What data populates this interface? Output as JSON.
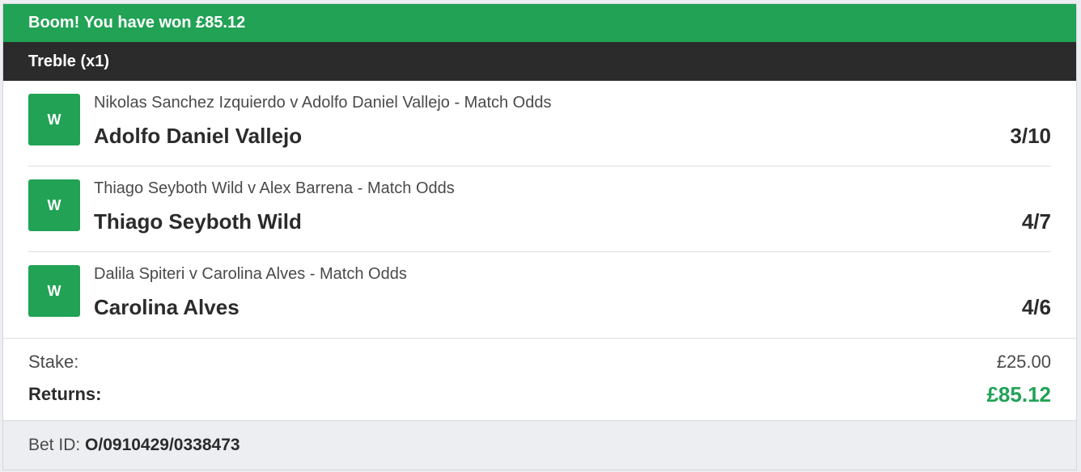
{
  "banner": {
    "text": "Boom! You have won £85.12",
    "color": "#21a255"
  },
  "bet_type": {
    "label": "Treble (x1)"
  },
  "legs": [
    {
      "result": "W",
      "event": "Nikolas Sanchez Izquierdo v Adolfo Daniel Vallejo - Match Odds",
      "selection": "Adolfo Daniel Vallejo",
      "odds": "3/10"
    },
    {
      "result": "W",
      "event": "Thiago Seyboth Wild v Alex Barrena - Match Odds",
      "selection": "Thiago Seyboth Wild",
      "odds": "4/7"
    },
    {
      "result": "W",
      "event": "Dalila Spiteri v Carolina Alves - Match Odds",
      "selection": "Carolina Alves",
      "odds": "4/6"
    }
  ],
  "summary": {
    "stake_label": "Stake:",
    "stake_value": "£25.00",
    "returns_label": "Returns:",
    "returns_value": "£85.12",
    "returns_color": "#21a255"
  },
  "footer": {
    "bet_id_label": "Bet ID:",
    "bet_id_value": "O/0910429/0338473"
  }
}
